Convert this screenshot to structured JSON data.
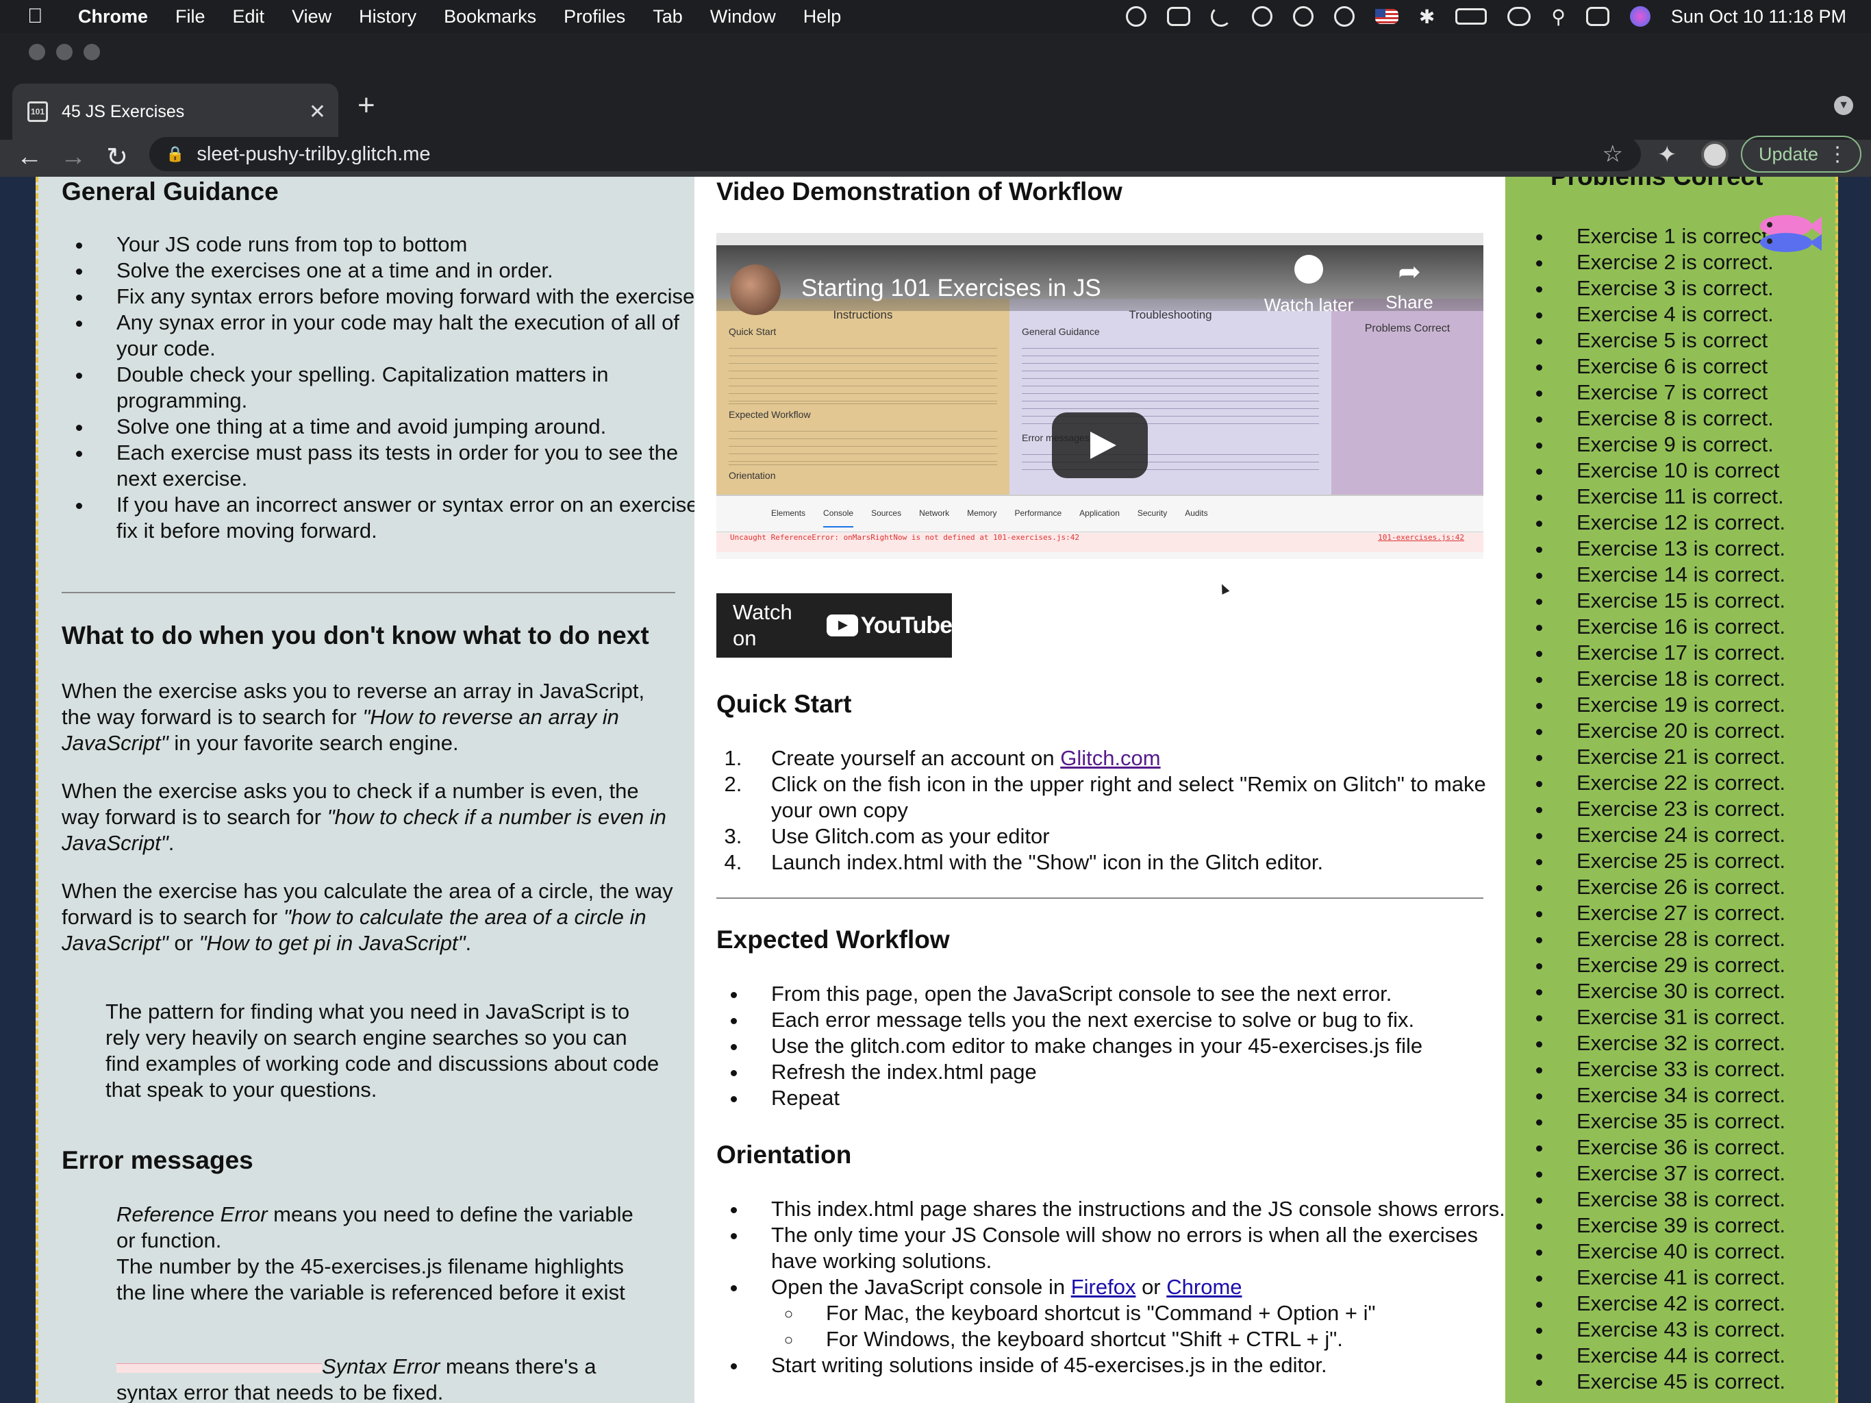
{
  "menubar": {
    "app": "Chrome",
    "items": [
      "File",
      "Edit",
      "View",
      "History",
      "Bookmarks",
      "Profiles",
      "Tab",
      "Window",
      "Help"
    ],
    "clock": "Sun Oct 10  11:18 PM"
  },
  "browser": {
    "tab_title": "45 JS Exercises",
    "favicon_text": "101",
    "url": "sleet-pushy-trilby.glitch.me",
    "update_label": "Update"
  },
  "left": {
    "guidance_title": "General Guidance",
    "guidance_items": [
      "Your JS code runs from top to bottom",
      "Solve the exercises one at a time and in order.",
      "Fix any syntax errors before moving forward with the exercises",
      "Any synax error in your code may halt the execution of all of your code.",
      "Double check your spelling. Capitalization matters in programming.",
      "Solve one thing at a time and avoid jumping around.",
      "Each exercise must pass its tests in order for you to see the next exercise.",
      "If you have an incorrect answer or syntax error on an exercise, fix it before moving forward."
    ],
    "next_title": "What to do when you don't know what to do next",
    "p1_a": "When the exercise asks you to reverse an array in JavaScript, the way forward is to search for ",
    "p1_i": "\"How to reverse an array in JavaScript\"",
    "p1_b": " in your favorite search engine.",
    "p2_a": "When the exercise asks you to check if a number is even, the way forward is to search for ",
    "p2_i": "\"how to check if a number is even in JavaScript\"",
    "p2_b": ".",
    "p3_a": "When the exercise has you calculate the area of a circle, the way forward is to search for ",
    "p3_i1": "\"how to calculate the area of a circle in JavaScript\"",
    "p3_or": " or ",
    "p3_i2": "\"How to get pi in JavaScript\"",
    "p3_b": ".",
    "quote": "The pattern for finding what you need in JavaScript is to rely very heavily on search engine searches so you can find examples of working code and discussions about code that speak to your questions.",
    "errors_title": "Error messages",
    "ref_i": "Reference Error",
    "ref_text": " means you need to define the variable or function.",
    "ref_text2": "The number by the 45-exercises.js filename highlights the line where the variable is referenced before it exist",
    "syn_i": "Syntax Error",
    "syn_text": " means there's a syntax error that needs to be fixed."
  },
  "middle": {
    "video_title": "Video Demonstration of Workflow",
    "video": {
      "title": "Starting 101 Exercises in JS",
      "watch_later": "Watch later",
      "share": "Share",
      "watch_on": "Watch on",
      "youtube": "YouTube",
      "pane1_title": "Instructions",
      "pane1_sub1": "Quick Start",
      "pane1_sub2": "Expected Workflow",
      "pane1_sub3": "Orientation",
      "pane2_title": "Troubleshooting",
      "pane2_sub1": "General Guidance",
      "pane2_sub2": "Error messages",
      "pane3_title": "Problems Correct",
      "console_tabs": [
        "Elements",
        "Console",
        "Sources",
        "Network",
        "Memory",
        "Performance",
        "Application",
        "Security",
        "Audits"
      ],
      "console_error": "Uncaught ReferenceError: onMarsRightNow is not defined at 101-exercises.js:42",
      "console_file": "101-exercises.js:42"
    },
    "quickstart_title": "Quick Start",
    "qs_1a": "Create yourself an account on ",
    "qs_1link": "Glitch.com",
    "qs_2": "Click on the fish icon in the upper right and select \"Remix on Glitch\" to make your own copy",
    "qs_3": "Use Glitch.com as your editor",
    "qs_4": "Launch index.html with the \"Show\" icon in the Glitch editor.",
    "workflow_title": "Expected Workflow",
    "workflow_items": [
      "From this page, open the JavaScript console to see the next error.",
      "Each error message tells you the next exercise to solve or bug to fix.",
      "Use the glitch.com editor to make changes in your 45-exercises.js file",
      "Refresh the index.html page",
      "Repeat"
    ],
    "orientation_title": "Orientation",
    "or_1": "This index.html page shares the instructions and the JS console shows errors.",
    "or_2": "The only time your JS Console will show no errors is when all the exercises have working solutions.",
    "or_3a": "Open the JavaScript console in ",
    "or_3firefox": "Firefox",
    "or_3or": " or ",
    "or_3chrome": "Chrome",
    "or_sub1": "For Mac, the keyboard shortcut is \"Command + Option + i\"",
    "or_sub2": "For Windows, the keyboard shortcut \"Shift + CTRL + j\".",
    "or_4": "Start writing solutions inside of 45-exercises.js in the editor."
  },
  "right": {
    "title": "Problems Correct",
    "items": [
      "Exercise 1 is correct.",
      "Exercise 2 is correct.",
      "Exercise 3 is correct.",
      "Exercise 4 is correct.",
      "Exercise 5 is correct",
      "Exercise 6 is correct",
      "Exercise 7 is correct",
      "Exercise 8 is correct.",
      "Exercise 9 is correct.",
      "Exercise 10 is correct",
      "Exercise 11 is correct.",
      "Exercise 12 is correct.",
      "Exercise 13 is correct.",
      "Exercise 14 is correct.",
      "Exercise 15 is correct.",
      "Exercise 16 is correct.",
      "Exercise 17 is correct.",
      "Exercise 18 is correct.",
      "Exercise 19 is correct.",
      "Exercise 20 is correct.",
      "Exercise 21 is correct.",
      "Exercise 22 is correct.",
      "Exercise 23 is correct.",
      "Exercise 24 is correct.",
      "Exercise 25 is correct.",
      "Exercise 26 is correct.",
      "Exercise 27 is correct.",
      "Exercise 28 is correct.",
      "Exercise 29 is correct.",
      "Exercise 30 is correct.",
      "Exercise 31 is correct.",
      "Exercise 32 is correct.",
      "Exercise 33 is correct.",
      "Exercise 34 is correct.",
      "Exercise 35 is correct.",
      "Exercise 36 is correct.",
      "Exercise 37 is correct.",
      "Exercise 38 is correct.",
      "Exercise 39 is correct.",
      "Exercise 40 is correct.",
      "Exercise 41 is correct.",
      "Exercise 42 is correct.",
      "Exercise 43 is correct.",
      "Exercise 44 is correct.",
      "Exercise 45 is correct."
    ]
  },
  "colors": {
    "left_bg": "#d7e0e0",
    "right_bg": "#91bf56",
    "page_bg": "#1e2b44",
    "border_dash": "#e8c545"
  }
}
